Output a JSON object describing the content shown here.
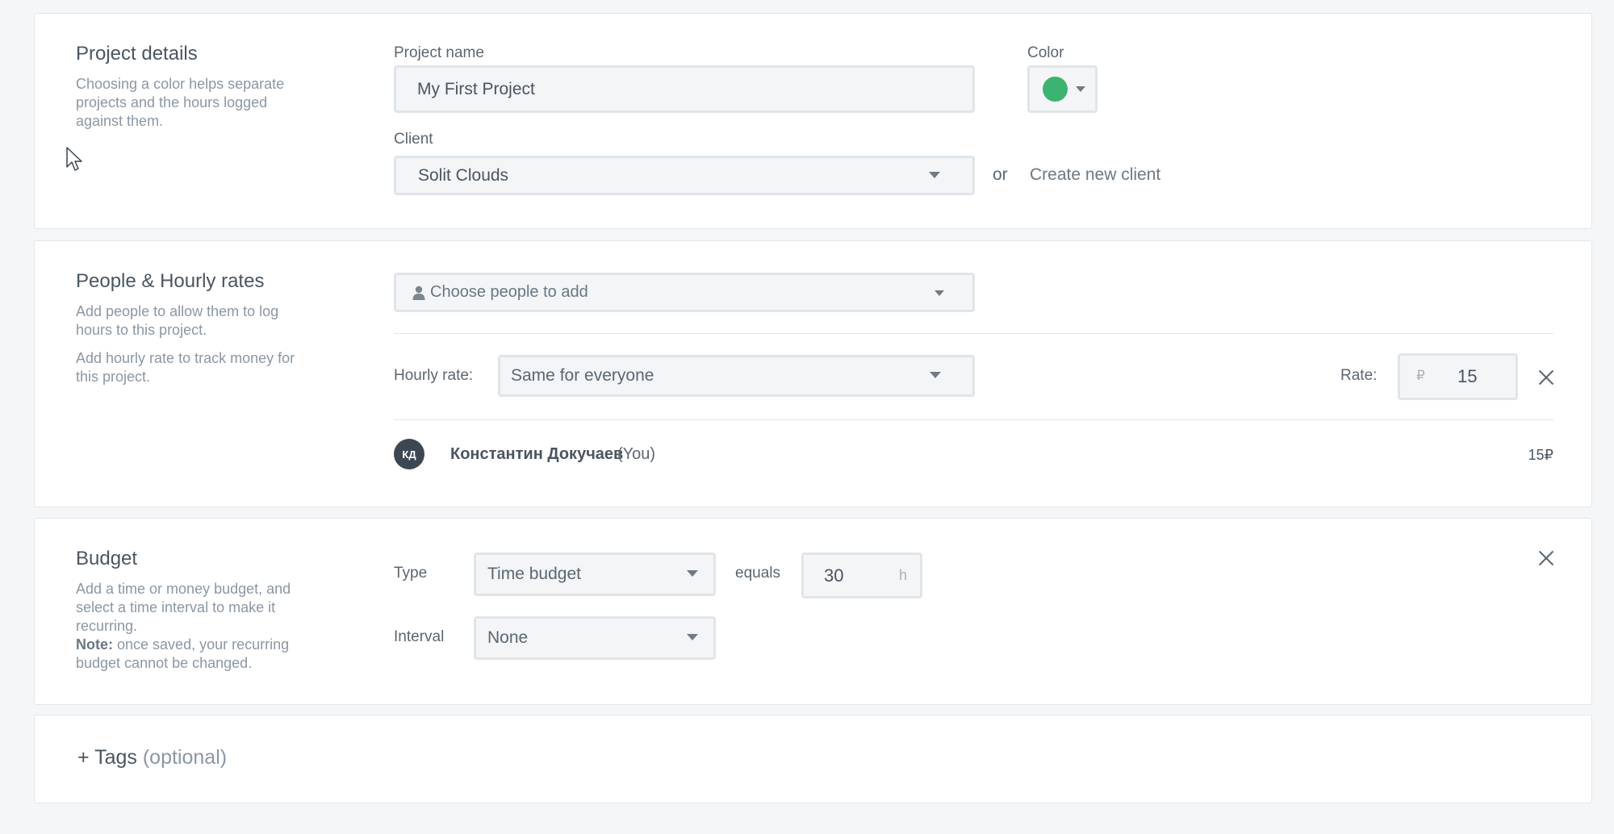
{
  "project_details": {
    "title": "Project details",
    "description": "Choosing a color helps separate projects and the hours logged against them.",
    "project_name_label": "Project name",
    "project_name_value": "My First Project",
    "color_label": "Color",
    "color_value": "#3cb371",
    "client_label": "Client",
    "client_value": "Solit Clouds",
    "or_text": "or",
    "create_client_link": "Create new client"
  },
  "people": {
    "title": "People & Hourly rates",
    "description_1": "Add people to allow them to log hours to this project.",
    "description_2": "Add hourly rate to track money for this project.",
    "choose_people_placeholder": "Choose people to add",
    "hourly_rate_label": "Hourly rate:",
    "hourly_rate_value": "Same for everyone",
    "rate_label": "Rate:",
    "rate_currency": "₽",
    "rate_value": "15",
    "members": [
      {
        "initials": "КД",
        "name": "Константин Докучаев",
        "suffix": "(You)",
        "rate": "15₽"
      }
    ]
  },
  "budget": {
    "title": "Budget",
    "description": "Add a time or money budget, and select a time interval to make it recurring.",
    "note_label": "Note:",
    "note_text": "once saved, your recurring budget cannot be changed.",
    "type_label": "Type",
    "type_value": "Time budget",
    "equals_label": "equals",
    "amount_value": "30",
    "amount_unit": "h",
    "interval_label": "Interval",
    "interval_value": "None"
  },
  "tags": {
    "label": "+ Tags",
    "optional": "(optional)"
  },
  "icons": {
    "close": "close-icon",
    "caret": "chevron-down-icon",
    "person": "person-icon",
    "cursor": "mouse-pointer-icon"
  }
}
